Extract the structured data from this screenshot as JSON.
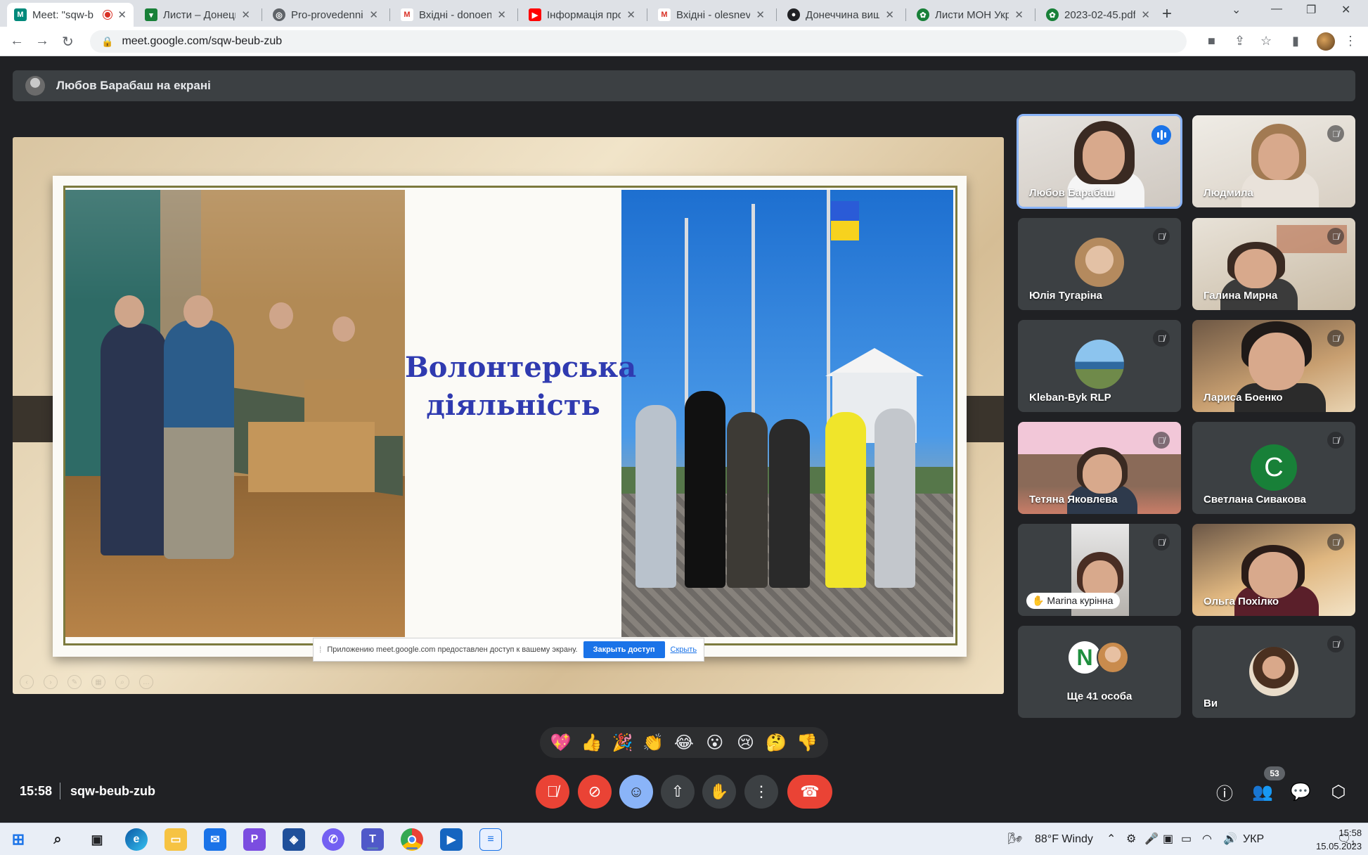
{
  "browser": {
    "tabs": [
      {
        "label": "Meet: \"sqw-b",
        "favicon": "meet-icon",
        "color": "#00897b",
        "active": true,
        "recording": true
      },
      {
        "label": "Листи – Донецьк",
        "favicon": "shield-icon",
        "color": "#188038"
      },
      {
        "label": "Pro-provedennia",
        "favicon": "globe-icon",
        "color": "#5f6368"
      },
      {
        "label": "Вхідні - donoenc",
        "favicon": "gmail-icon",
        "color": "#d93025"
      },
      {
        "label": "Інформація про",
        "favicon": "youtube-icon",
        "color": "#ff0000"
      },
      {
        "label": "Вхідні - olesnevic",
        "favicon": "gmail-icon",
        "color": "#d93025"
      },
      {
        "label": "Донеччина вищ",
        "favicon": "site-icon",
        "color": "#202124"
      },
      {
        "label": "Листи МОН Укра",
        "favicon": "emblem-icon",
        "color": "#188038"
      },
      {
        "label": "2023-02-45.pdf",
        "favicon": "emblem-icon",
        "color": "#188038"
      }
    ],
    "url": "meet.google.com/sqw-beub-zub"
  },
  "meet": {
    "presenter_banner": "Любов Барабаш на екрані",
    "slide": {
      "title_line1": "Волонтерська",
      "title_line2": "діяльність"
    },
    "share_notice": {
      "text": "Приложению meet.google.com предоставлен доступ к вашему экрану.",
      "stop_label": "Закрыть доступ",
      "hide_label": "Скрыть"
    },
    "participants": [
      {
        "name": "Любов Барабаш",
        "speaking": true
      },
      {
        "name": "Людмила",
        "muted": true
      },
      {
        "name": "Юлія Тугаріна",
        "muted": true
      },
      {
        "name": "Галина Мирна",
        "muted": true
      },
      {
        "name": "Kleban-Byk RLP",
        "muted": true
      },
      {
        "name": "Лариса Боенко",
        "muted": true
      },
      {
        "name": "Тетяна Яковлева",
        "muted": true
      },
      {
        "name": "Светлана Сивакова",
        "muted": true,
        "initial": "С"
      },
      {
        "name": "Маrina курінна",
        "muted": true
      },
      {
        "name": "Ольга Похілко",
        "muted": true
      },
      {
        "name": "Ще 41 особа"
      },
      {
        "name": "Ви",
        "muted": true
      }
    ],
    "reactions": [
      "💖",
      "👍",
      "🎉",
      "👏",
      "😂",
      "😮",
      "😢",
      "🤔",
      "👎"
    ],
    "time": "15:58",
    "meeting_code": "sqw-beub-zub",
    "participant_count": "53"
  },
  "taskbar": {
    "weather": "88°F Windy",
    "language": "УКР",
    "clock_time": "15:58",
    "clock_date": "15.05.2023",
    "notification_count": "1"
  }
}
